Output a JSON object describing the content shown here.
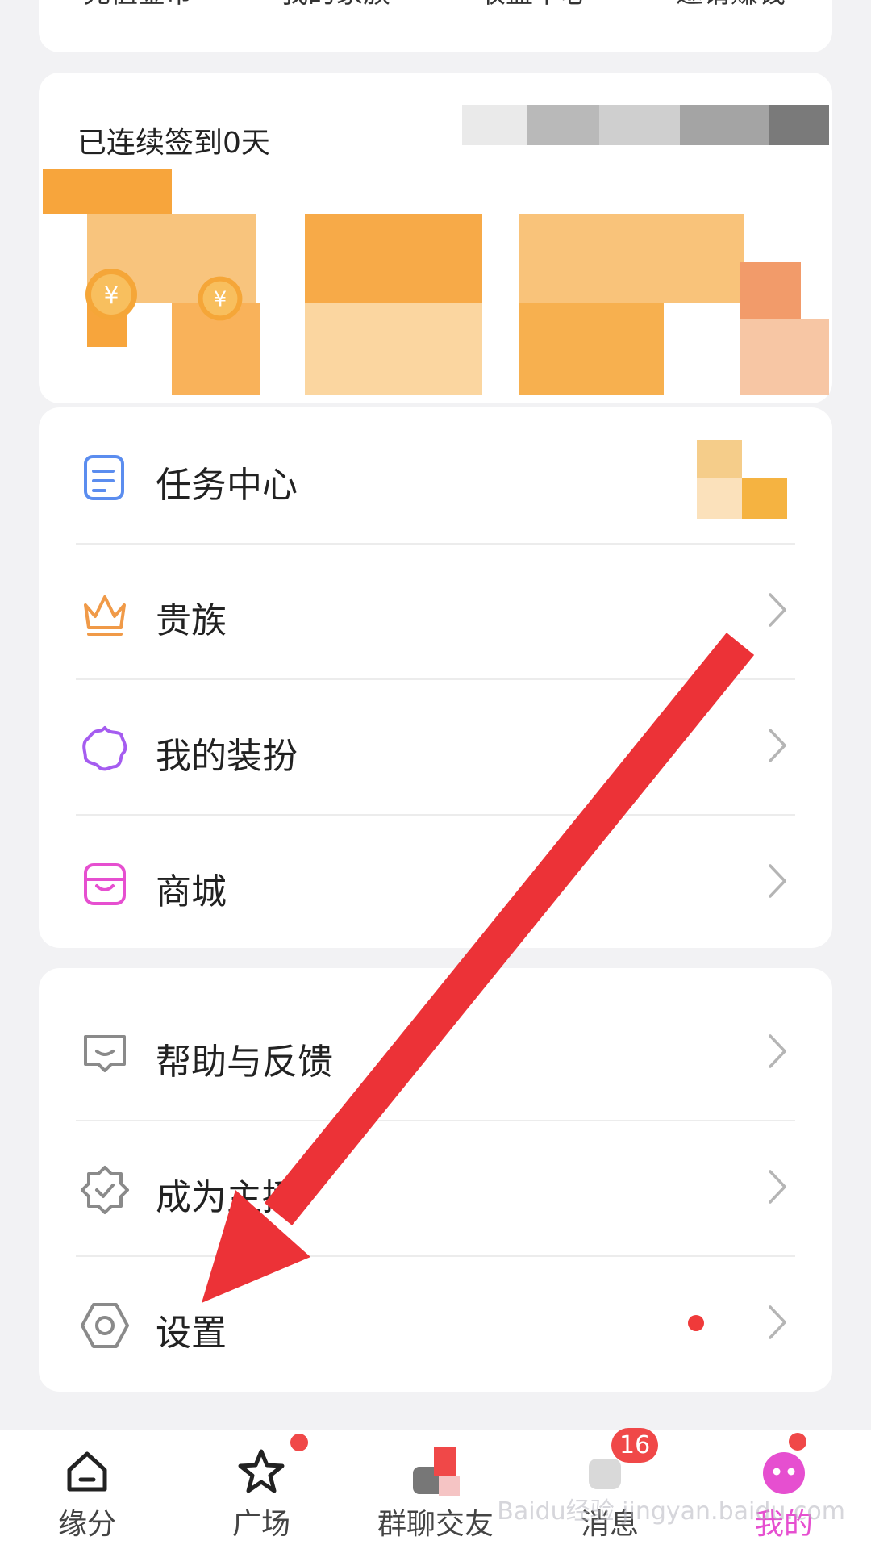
{
  "quick_menu": {
    "items": [
      {
        "label": "充值金币"
      },
      {
        "label": "我的家族"
      },
      {
        "label": "收益中心"
      },
      {
        "label": "邀请赚钱"
      }
    ]
  },
  "sign_in": {
    "title": "已连续签到0天"
  },
  "menu_section": {
    "items": [
      {
        "label": "任务中心",
        "icon": "document-icon"
      },
      {
        "label": "贵族",
        "icon": "crown-icon"
      },
      {
        "label": "我的装扮",
        "icon": "sparkle-icon"
      },
      {
        "label": "商城",
        "icon": "store-icon"
      }
    ]
  },
  "support_section": {
    "items": [
      {
        "label": "帮助与反馈",
        "icon": "chat-icon"
      },
      {
        "label": "成为主播",
        "icon": "badge-icon"
      },
      {
        "label": "设置",
        "icon": "settings-icon",
        "has_dot": true
      }
    ]
  },
  "tabbar": {
    "items": [
      {
        "label": "缘分",
        "icon": "home-icon"
      },
      {
        "label": "广场",
        "icon": "star-icon",
        "has_dot": true
      },
      {
        "label": "群聊交友",
        "icon": "group-icon"
      },
      {
        "label": "消息",
        "icon": "message-icon",
        "badge": "16"
      },
      {
        "label": "我的",
        "icon": "avatar-icon",
        "active": true,
        "has_dot": true
      }
    ]
  },
  "colors": {
    "accent_pink": "#e64fd0",
    "badge_red": "#f04848",
    "arrow_red": "#ec3237",
    "coin_orange": "#f5a638"
  },
  "watermark": "Baidu经验 jingyan.baidu.com"
}
